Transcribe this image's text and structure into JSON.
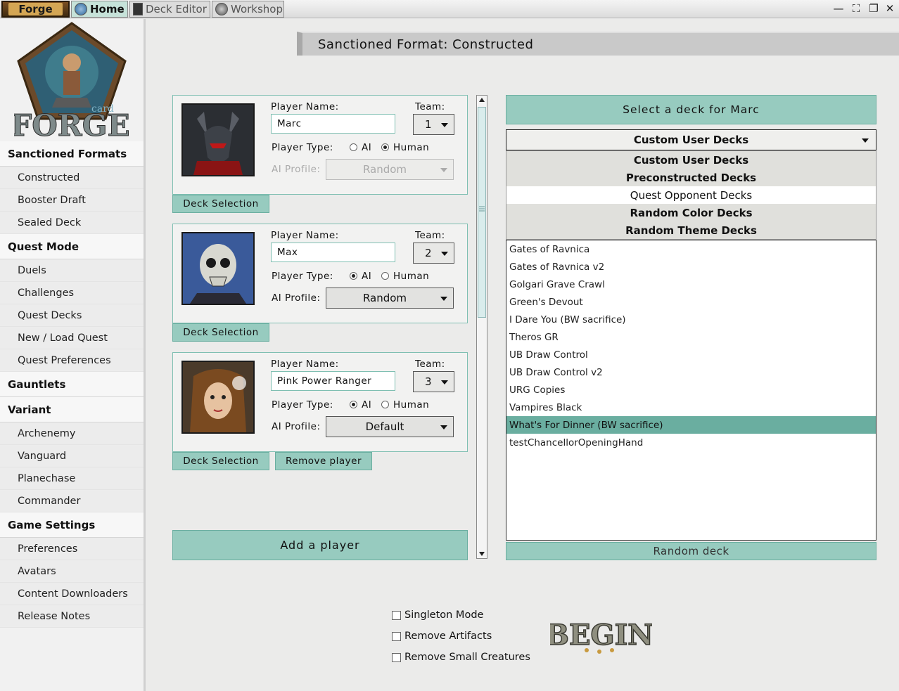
{
  "tabs": {
    "forge": "Forge",
    "home": "Home",
    "deck_editor": "Deck Editor",
    "workshop": "Workshop"
  },
  "window_controls": {
    "minimize": "—",
    "fullscreen": "⛶",
    "restore": "❐",
    "close": "✕"
  },
  "logo": {
    "small_text": "card",
    "big_text": "FORGE"
  },
  "sidebar": {
    "sections": [
      {
        "label": "Sanctioned Formats",
        "items": [
          "Constructed",
          "Booster Draft",
          "Sealed Deck"
        ]
      },
      {
        "label": "Quest Mode",
        "items": [
          "Duels",
          "Challenges",
          "Quest Decks",
          "New / Load Quest",
          "Quest Preferences"
        ]
      },
      {
        "label": "Gauntlets",
        "items": []
      },
      {
        "label": "Variant",
        "items": [
          "Archenemy",
          "Vanguard",
          "Planechase",
          "Commander"
        ]
      },
      {
        "label": "Game Settings",
        "items": [
          "Preferences",
          "Avatars",
          "Content Downloaders",
          "Release Notes"
        ]
      }
    ]
  },
  "main": {
    "title": "Sanctioned Format: Constructed"
  },
  "labels": {
    "player_name": "Player Name:",
    "team": "Team:",
    "player_type": "Player Type:",
    "ai": "AI",
    "human": "Human",
    "ai_profile": "AI Profile:",
    "deck_selection": "Deck Selection",
    "remove_player": "Remove player",
    "add_player": "Add a player"
  },
  "players": [
    {
      "name": "Marc",
      "team": "1",
      "type": "Human",
      "ai_profile": "Random",
      "ai_profile_enabled": false
    },
    {
      "name": "Max",
      "team": "2",
      "type": "AI",
      "ai_profile": "Random",
      "ai_profile_enabled": true
    },
    {
      "name": "Pink Power Ranger",
      "team": "3",
      "type": "AI",
      "ai_profile": "Default",
      "ai_profile_enabled": true
    }
  ],
  "deck_panel": {
    "header": "Select a deck for Marc",
    "selected_type": "Custom User Decks",
    "type_options": [
      "Custom User Decks",
      "Preconstructed Decks",
      "Quest Opponent Decks",
      "Random Color Decks",
      "Random Theme Decks"
    ],
    "highlighted_option": "Quest Opponent Decks",
    "decks": [
      "Gates of Ravnica",
      "Gates of Ravnica v2",
      "Golgari Grave Crawl",
      "Green's Devout",
      "I Dare You (BW sacrifice)",
      "Theros GR",
      "UB Draw Control",
      "UB Draw Control v2",
      "URG Copies",
      "Vampires Black",
      "What's For Dinner (BW sacrifice)",
      "testChancellorOpeningHand"
    ],
    "selected_deck": "What's For Dinner (BW sacrifice)",
    "random_deck": "Random deck"
  },
  "options": {
    "singleton": "Singleton Mode",
    "remove_artifacts": "Remove Artifacts",
    "remove_small_creatures": "Remove Small Creatures"
  },
  "begin": "BEGIN",
  "colors": {
    "accent": "#97cbbf",
    "accent_border": "#6aaea0",
    "selected_row": "#6aaea0"
  }
}
